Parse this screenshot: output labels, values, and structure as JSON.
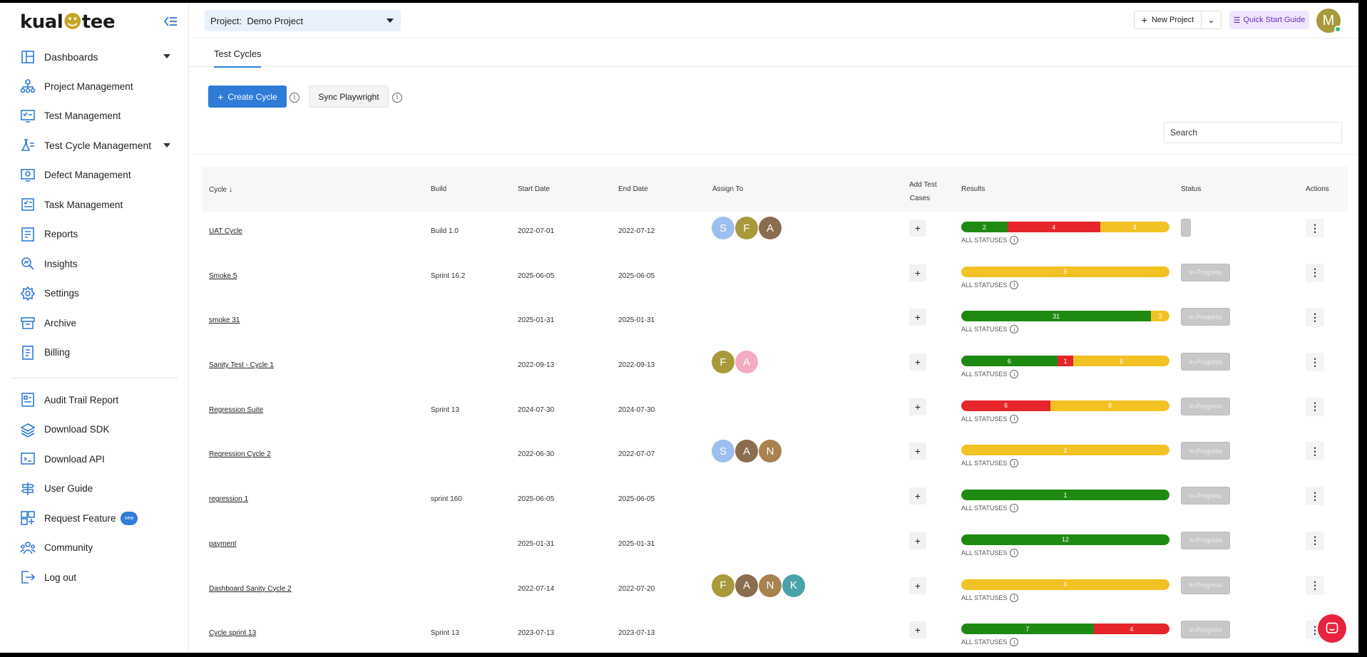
{
  "brand": {
    "logo_text_a": "kual",
    "logo_text_owl": "☻",
    "logo_text_b": "tee"
  },
  "sidebar": {
    "items": [
      {
        "label": "Dashboards",
        "icon": "dashboard-icon",
        "expandable": true
      },
      {
        "label": "Project Management",
        "icon": "project-icon"
      },
      {
        "label": "Test Management",
        "icon": "test-management-icon"
      },
      {
        "label": "Test Cycle Management",
        "icon": "flask-icon",
        "expandable": true
      },
      {
        "label": "Defect Management",
        "icon": "defect-icon"
      },
      {
        "label": "Task Management",
        "icon": "task-icon"
      },
      {
        "label": "Reports",
        "icon": "reports-icon"
      },
      {
        "label": "Insights",
        "icon": "insights-icon"
      },
      {
        "label": "Settings",
        "icon": "gear-icon"
      },
      {
        "label": "Archive",
        "icon": "archive-icon"
      },
      {
        "label": "Billing",
        "icon": "billing-icon"
      }
    ],
    "secondary": [
      {
        "label": "Audit Trail Report",
        "icon": "audit-icon"
      },
      {
        "label": "Download SDK",
        "icon": "layers-icon"
      },
      {
        "label": "Download API",
        "icon": "api-icon"
      },
      {
        "label": "User Guide",
        "icon": "guide-icon"
      },
      {
        "label": "Request Feature",
        "icon": "request-icon",
        "badge": "new"
      },
      {
        "label": "Community",
        "icon": "community-icon"
      },
      {
        "label": "Log out",
        "icon": "logout-icon"
      }
    ]
  },
  "header": {
    "project_label": "Project:",
    "project_value": "Demo Project",
    "new_project": "New Project",
    "quick_start": "Quick Start Guide",
    "avatar_letter": "M"
  },
  "tabs": {
    "active": "Test Cycles"
  },
  "toolbar": {
    "create_cycle": "Create Cycle",
    "sync_playwright": "Sync Playwright",
    "search_placeholder": "Search"
  },
  "table": {
    "headers": {
      "cycle": "Cycle",
      "build": "Build",
      "start_date": "Start Date",
      "end_date": "End Date",
      "assign_to": "Assign To",
      "add_test_cases_1": "Add Test",
      "add_test_cases_2": "Cases",
      "results": "Results",
      "status": "Status",
      "actions": "Actions"
    },
    "all_statuses": "ALL STATUSES",
    "rows": [
      {
        "cycle": "UAT Cycle",
        "build": "Build 1.0",
        "start": "2022-07-01",
        "end": "2022-07-12",
        "assignees": [
          {
            "l": "S",
            "c": "#9cbff0"
          },
          {
            "l": "F",
            "c": "#a89a3b"
          },
          {
            "l": "A",
            "c": "#8a6d4e"
          }
        ],
        "results": [
          {
            "t": "g",
            "v": 2
          },
          {
            "t": "r",
            "v": 4
          },
          {
            "t": "y",
            "v": 3
          }
        ],
        "status": ""
      },
      {
        "cycle": "Smoke 5",
        "build": "Sprint 16.2",
        "start": "2025-06-05",
        "end": "2025-06-05",
        "assignees": [],
        "results": [
          {
            "t": "y",
            "v": 5
          }
        ],
        "status": "In-Progress"
      },
      {
        "cycle": "smoke 31",
        "build": "",
        "start": "2025-01-31",
        "end": "2025-01-31",
        "assignees": [],
        "results": [
          {
            "t": "g",
            "v": 31
          },
          {
            "t": "y",
            "v": 3
          }
        ],
        "status": "In-Progress"
      },
      {
        "cycle": "Sanity Test - Cycle 1",
        "build": "",
        "start": "2022-09-13",
        "end": "2022-09-13",
        "assignees": [
          {
            "l": "F",
            "c": "#a89a3b"
          },
          {
            "l": "A",
            "c": "#f4aac0"
          }
        ],
        "results": [
          {
            "t": "g",
            "v": 6
          },
          {
            "t": "r",
            "v": 1
          },
          {
            "t": "y",
            "v": 6
          }
        ],
        "status": "In-Progress"
      },
      {
        "cycle": "Regression Suite",
        "build": "Sprint 13",
        "start": "2024-07-30",
        "end": "2024-07-30",
        "assignees": [],
        "results": [
          {
            "t": "r",
            "v": 6
          },
          {
            "t": "y",
            "v": 8
          }
        ],
        "status": "In-Progress"
      },
      {
        "cycle": "Regression Cycle 2",
        "build": "",
        "start": "2022-06-30",
        "end": "2022-07-07",
        "assignees": [
          {
            "l": "S",
            "c": "#9cbff0"
          },
          {
            "l": "A",
            "c": "#8a6d4e"
          },
          {
            "l": "N",
            "c": "#a8824f"
          }
        ],
        "results": [
          {
            "t": "y",
            "v": 2
          }
        ],
        "status": "In-Progress"
      },
      {
        "cycle": "regression 1",
        "build": "sprint 160",
        "start": "2025-06-05",
        "end": "2025-06-05",
        "assignees": [],
        "results": [
          {
            "t": "g",
            "v": 1
          }
        ],
        "status": "In-Progress"
      },
      {
        "cycle": "payment",
        "build": "",
        "start": "2025-01-31",
        "end": "2025-01-31",
        "assignees": [],
        "results": [
          {
            "t": "g",
            "v": 12
          }
        ],
        "status": "In-Progress"
      },
      {
        "cycle": "Dashboard Sanity Cycle 2",
        "build": "",
        "start": "2022-07-14",
        "end": "2022-07-20",
        "assignees": [
          {
            "l": "F",
            "c": "#a89a3b"
          },
          {
            "l": "A",
            "c": "#8a6d4e"
          },
          {
            "l": "N",
            "c": "#a8824f"
          },
          {
            "l": "K",
            "c": "#4aa3a8"
          }
        ],
        "results": [
          {
            "t": "y",
            "v": 6
          }
        ],
        "status": "In-Progress"
      },
      {
        "cycle": "Cycle sprint 13",
        "build": "Sprint 13",
        "start": "2023-07-13",
        "end": "2023-07-13",
        "assignees": [],
        "results": [
          {
            "t": "g",
            "v": 7
          },
          {
            "t": "r",
            "v": 4
          }
        ],
        "status": "In-Progress"
      }
    ]
  },
  "colors": {
    "accent": "#2f7bd8",
    "pass": "#1f8a12",
    "fail": "#e5252a",
    "pending": "#f2c124"
  }
}
